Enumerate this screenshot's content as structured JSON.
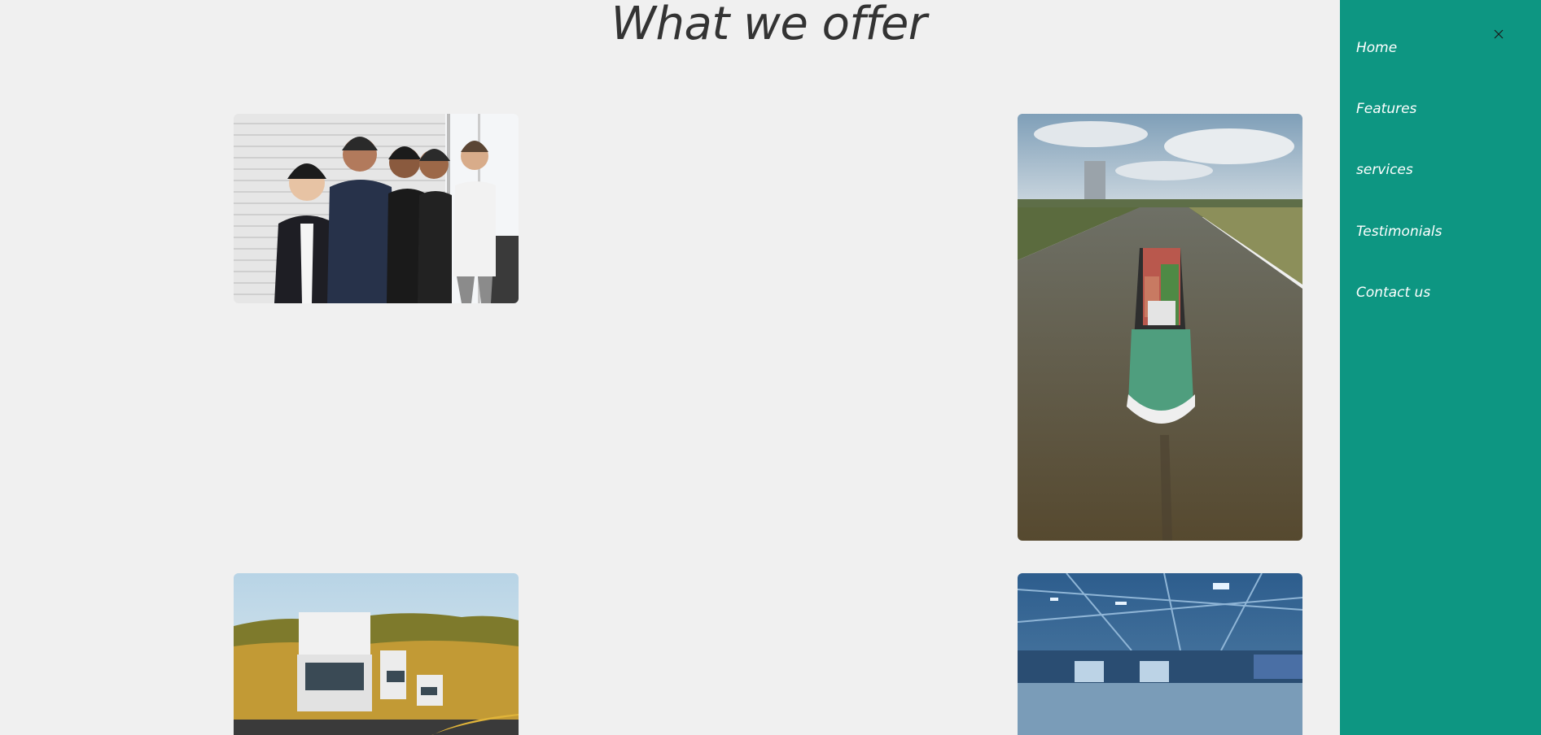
{
  "section": {
    "title": "What we offer"
  },
  "sidebar": {
    "background": "#0d9682",
    "close_icon": "close-icon",
    "items": [
      {
        "label": "Home"
      },
      {
        "label": "Features"
      },
      {
        "label": "services"
      },
      {
        "label": "Testimonials"
      },
      {
        "label": "Contact us"
      }
    ]
  },
  "images": [
    {
      "name": "team-photo"
    },
    {
      "name": "cargo-ship-photo"
    },
    {
      "name": "trucks-photo"
    },
    {
      "name": "warehouse-photo"
    }
  ]
}
